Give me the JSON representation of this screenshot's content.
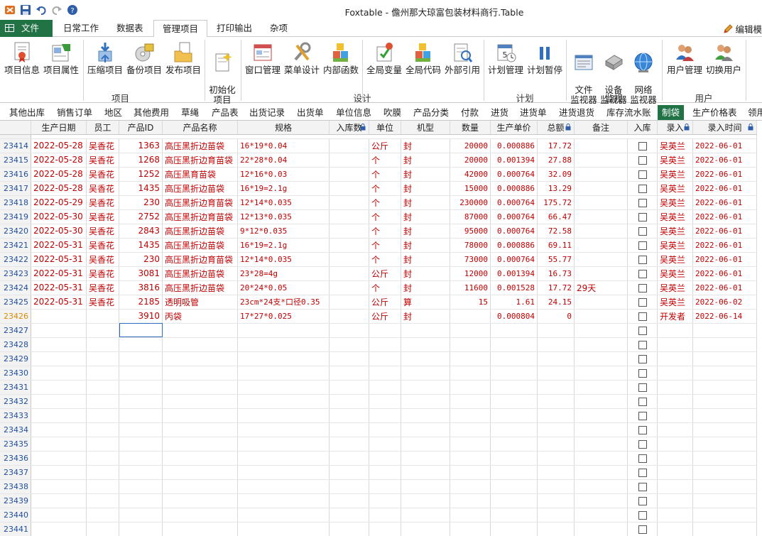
{
  "window": {
    "title": "Foxtable - 儋州那大琼富包装材料商行.Table"
  },
  "ribbon_tabs": [
    "文件",
    "日常工作",
    "数据表",
    "管理项目",
    "打印输出",
    "杂项"
  ],
  "edit_mode_label": "编辑模",
  "ribbon_groups": {
    "project": {
      "label": "项目",
      "buttons": [
        "项目信息",
        "项目属性",
        "压缩项目",
        "备份项目",
        "发布项目",
        "初始化\n项目"
      ]
    },
    "design": {
      "label": "设计",
      "buttons": [
        "窗口管理",
        "菜单设计",
        "内部函数",
        "全局变量",
        "全局代码",
        "外部引用"
      ]
    },
    "plan": {
      "label": "计划",
      "buttons": [
        "计划管理",
        "计划暂停"
      ]
    },
    "monitor": {
      "label": "监视",
      "buttons": [
        "文件\n监视器",
        "设备\n监视器",
        "网络\n监视器"
      ]
    },
    "user": {
      "label": "用户",
      "buttons": [
        "用户管理",
        "切换用户"
      ]
    }
  },
  "table_tabs": [
    "其他出库",
    "销售订单",
    "地区",
    "其他费用",
    "草绳",
    "产品表",
    "出货记录",
    "出货单",
    "单位信息",
    "吹膜",
    "产品分类",
    "付款",
    "进货",
    "进货单",
    "进货退货",
    "库存流水账",
    "制袋",
    "生产价格表",
    "领用"
  ],
  "active_table_tab": "制袋",
  "columns": [
    "生产日期",
    "员工",
    "产品ID",
    "产品名称",
    "规格",
    "入库数",
    "单位",
    "机型",
    "数量",
    "生产单价",
    "总额",
    "备注",
    "入库",
    "录入",
    "录入时间"
  ],
  "rows": [
    {
      "no": "23414",
      "date": "2022-05-28",
      "emp": "吴香花",
      "pid": "1363",
      "name": "高压黑折边苗袋",
      "spec": "16*19*0.04",
      "inqty": "",
      "unit": "公斤",
      "type": "封",
      "qty": "20000",
      "price": "0.000886",
      "total": "17.72",
      "note": "",
      "entry": "吴英兰",
      "etime": "2022-06-01"
    },
    {
      "no": "23415",
      "date": "2022-05-28",
      "emp": "吴香花",
      "pid": "1268",
      "name": "高压黑折边育苗袋",
      "spec": "22*28*0.04",
      "inqty": "",
      "unit": "个",
      "type": "封",
      "qty": "20000",
      "price": "0.001394",
      "total": "27.88",
      "note": "",
      "entry": "吴英兰",
      "etime": "2022-06-01"
    },
    {
      "no": "23416",
      "date": "2022-05-28",
      "emp": "吴香花",
      "pid": "1252",
      "name": "高压黑育苗袋",
      "spec": "12*16*0.03",
      "inqty": "",
      "unit": "个",
      "type": "封",
      "qty": "42000",
      "price": "0.000764",
      "total": "32.09",
      "note": "",
      "entry": "吴英兰",
      "etime": "2022-06-01"
    },
    {
      "no": "23417",
      "date": "2022-05-28",
      "emp": "吴香花",
      "pid": "1435",
      "name": "高压黑折边苗袋",
      "spec": "16*19=2.1g",
      "inqty": "",
      "unit": "个",
      "type": "封",
      "qty": "15000",
      "price": "0.000886",
      "total": "13.29",
      "note": "",
      "entry": "吴英兰",
      "etime": "2022-06-01"
    },
    {
      "no": "23418",
      "date": "2022-05-29",
      "emp": "吴香花",
      "pid": "230",
      "name": "高压黑折边育苗袋",
      "spec": "12*14*0.035",
      "inqty": "",
      "unit": "个",
      "type": "封",
      "qty": "230000",
      "price": "0.000764",
      "total": "175.72",
      "note": "",
      "entry": "吴英兰",
      "etime": "2022-06-01"
    },
    {
      "no": "23419",
      "date": "2022-05-30",
      "emp": "吴香花",
      "pid": "2752",
      "name": "高压黑折边育苗袋",
      "spec": "12*13*0.035",
      "inqty": "",
      "unit": "个",
      "type": "封",
      "qty": "87000",
      "price": "0.000764",
      "total": "66.47",
      "note": "",
      "entry": "吴英兰",
      "etime": "2022-06-01"
    },
    {
      "no": "23420",
      "date": "2022-05-30",
      "emp": "吴香花",
      "pid": "2843",
      "name": "高压黑折边苗袋",
      "spec": "9*12*0.035",
      "inqty": "",
      "unit": "个",
      "type": "封",
      "qty": "95000",
      "price": "0.000764",
      "total": "72.58",
      "note": "",
      "entry": "吴英兰",
      "etime": "2022-06-01"
    },
    {
      "no": "23421",
      "date": "2022-05-31",
      "emp": "吴香花",
      "pid": "1435",
      "name": "高压黑折边苗袋",
      "spec": "16*19=2.1g",
      "inqty": "",
      "unit": "个",
      "type": "封",
      "qty": "78000",
      "price": "0.000886",
      "total": "69.11",
      "note": "",
      "entry": "吴英兰",
      "etime": "2022-06-01"
    },
    {
      "no": "23422",
      "date": "2022-05-31",
      "emp": "吴香花",
      "pid": "230",
      "name": "高压黑折边育苗袋",
      "spec": "12*14*0.035",
      "inqty": "",
      "unit": "个",
      "type": "封",
      "qty": "73000",
      "price": "0.000764",
      "total": "55.77",
      "note": "",
      "entry": "吴英兰",
      "etime": "2022-06-01"
    },
    {
      "no": "23423",
      "date": "2022-05-31",
      "emp": "吴香花",
      "pid": "3081",
      "name": "高压黑折边苗袋",
      "spec": "23*28=4g",
      "inqty": "",
      "unit": "公斤",
      "type": "封",
      "qty": "12000",
      "price": "0.001394",
      "total": "16.73",
      "note": "",
      "entry": "吴英兰",
      "etime": "2022-06-01"
    },
    {
      "no": "23424",
      "date": "2022-05-31",
      "emp": "吴香花",
      "pid": "3816",
      "name": "高压黑折边苗袋",
      "spec": "20*24*0.05",
      "inqty": "",
      "unit": "个",
      "type": "封",
      "qty": "11600",
      "price": "0.001528",
      "total": "17.72",
      "note": "29天",
      "entry": "吴英兰",
      "etime": "2022-06-01"
    },
    {
      "no": "23425",
      "date": "2022-05-31",
      "emp": "吴香花",
      "pid": "2185",
      "name": "透明吸管",
      "spec": "23cm*24支*口径0.35",
      "inqty": "",
      "unit": "公斤",
      "type": "算",
      "qty": "15",
      "price": "1.61",
      "total": "24.15",
      "note": "",
      "entry": "吴英兰",
      "etime": "2022-06-02"
    },
    {
      "no": "23426",
      "date": "",
      "emp": "",
      "pid": "3910",
      "name": "丙袋",
      "spec": "17*27*0.025",
      "inqty": "",
      "unit": "公斤",
      "type": "封",
      "qty": "",
      "price": "0.000804",
      "total": "0",
      "note": "",
      "entry": "开发者",
      "etime": "2022-06-14"
    }
  ],
  "empty_rows": [
    "23427",
    "23428",
    "23429",
    "23430",
    "23431",
    "23432",
    "23433",
    "23434",
    "23435",
    "23436",
    "23437",
    "23438",
    "23439",
    "23440",
    "23441"
  ]
}
